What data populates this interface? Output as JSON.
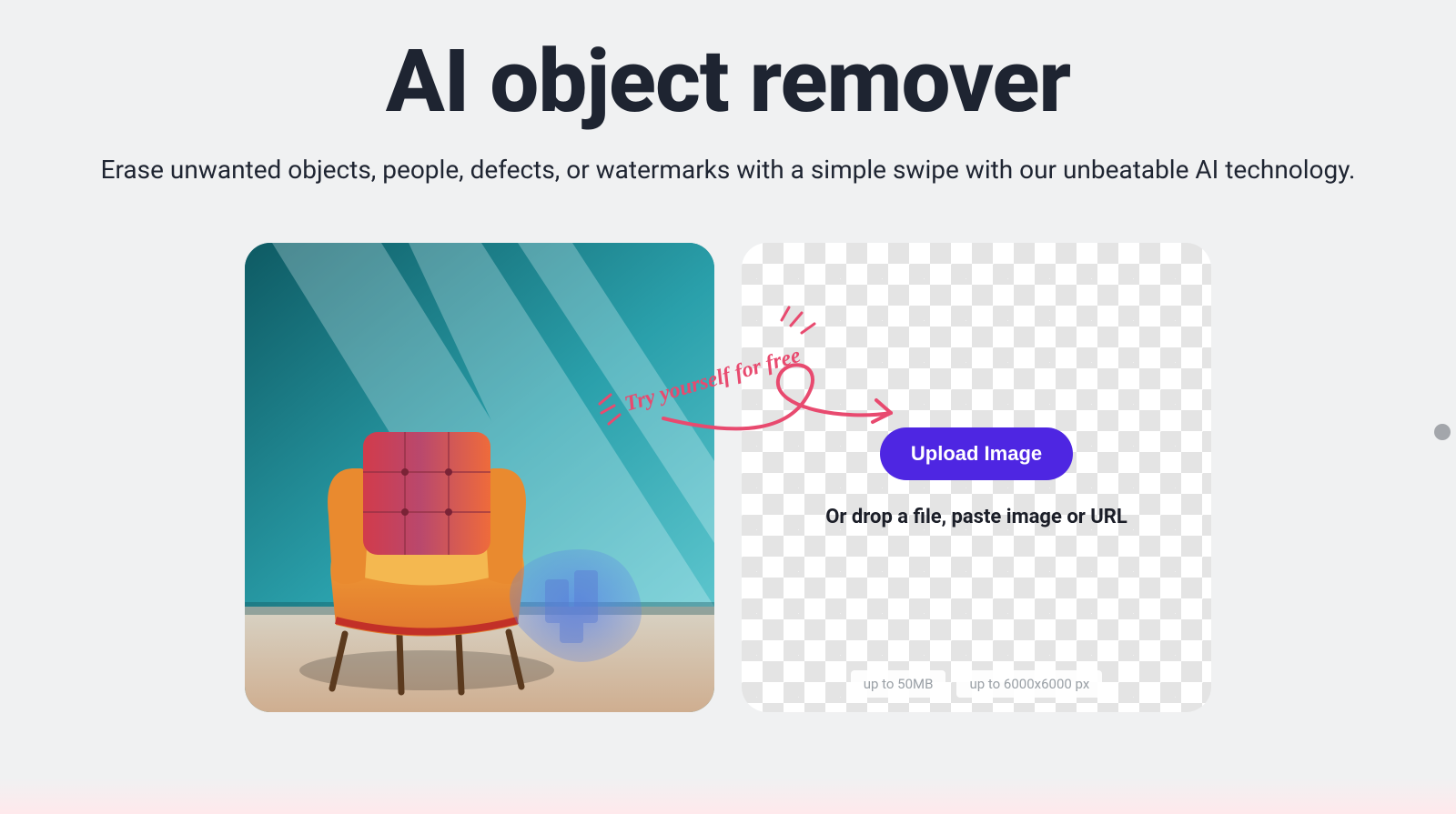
{
  "header": {
    "title": "AI object remover",
    "subtitle": "Erase unwanted objects, people, defects, or watermarks with a simple swipe with our unbeatable AI technology."
  },
  "callout": {
    "text": "Try yourself for free"
  },
  "upload": {
    "button_label": "Upload Image",
    "drop_hint": "Or drop a file, paste image or URL",
    "limit_size": "up to 50MB",
    "limit_dims": "up to 6000x6000 px"
  },
  "colors": {
    "accent": "#4e26e2",
    "callout": "#e84a6f"
  }
}
